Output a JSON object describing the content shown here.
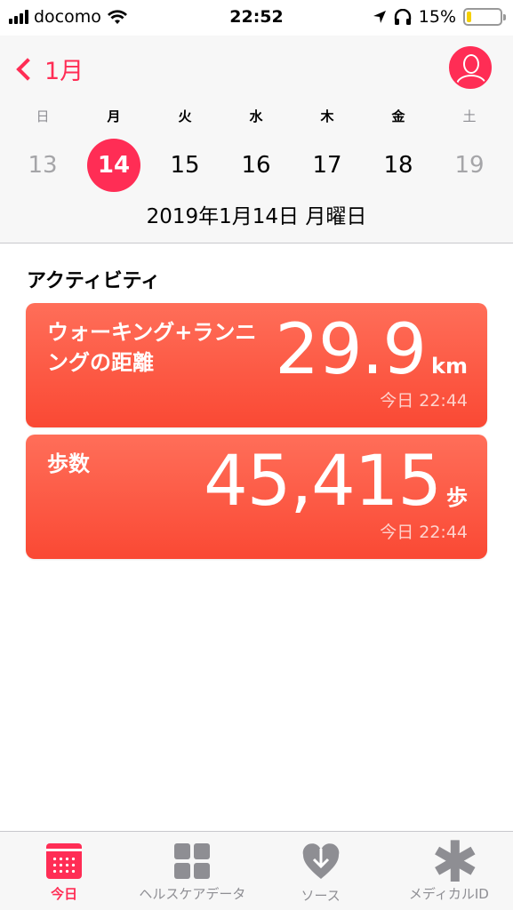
{
  "status_bar": {
    "carrier": "docomo",
    "time": "22:52",
    "battery_percent": "15%",
    "battery_level": 0.15
  },
  "header": {
    "back_label": "1月",
    "weekdays": [
      "日",
      "月",
      "火",
      "水",
      "木",
      "金",
      "土"
    ],
    "days": [
      "13",
      "14",
      "15",
      "16",
      "17",
      "18",
      "19"
    ],
    "selected_day_index": 1,
    "date_line": "2019年1月14日 月曜日"
  },
  "activity": {
    "title": "アクティビティ",
    "cards": [
      {
        "label": "ウォーキング+ランニングの距離",
        "value": "29.9",
        "unit": "km",
        "time": "今日 22:44"
      },
      {
        "label": "歩数",
        "value": "45,415",
        "unit": "歩",
        "time": "今日 22:44"
      }
    ]
  },
  "tab_bar": {
    "tabs": [
      {
        "label": "今日",
        "icon": "calendar-icon",
        "active": true
      },
      {
        "label": "ヘルスケアデータ",
        "icon": "grid-icon",
        "active": false
      },
      {
        "label": "ソース",
        "icon": "heart-download-icon",
        "active": false
      },
      {
        "label": "メディカルID",
        "icon": "asterisk-icon",
        "active": false
      }
    ]
  },
  "colors": {
    "accent": "#ff2d55",
    "card_top": "#ff6e59",
    "card_bottom": "#fa4934",
    "inactive": "#8e8e93"
  }
}
